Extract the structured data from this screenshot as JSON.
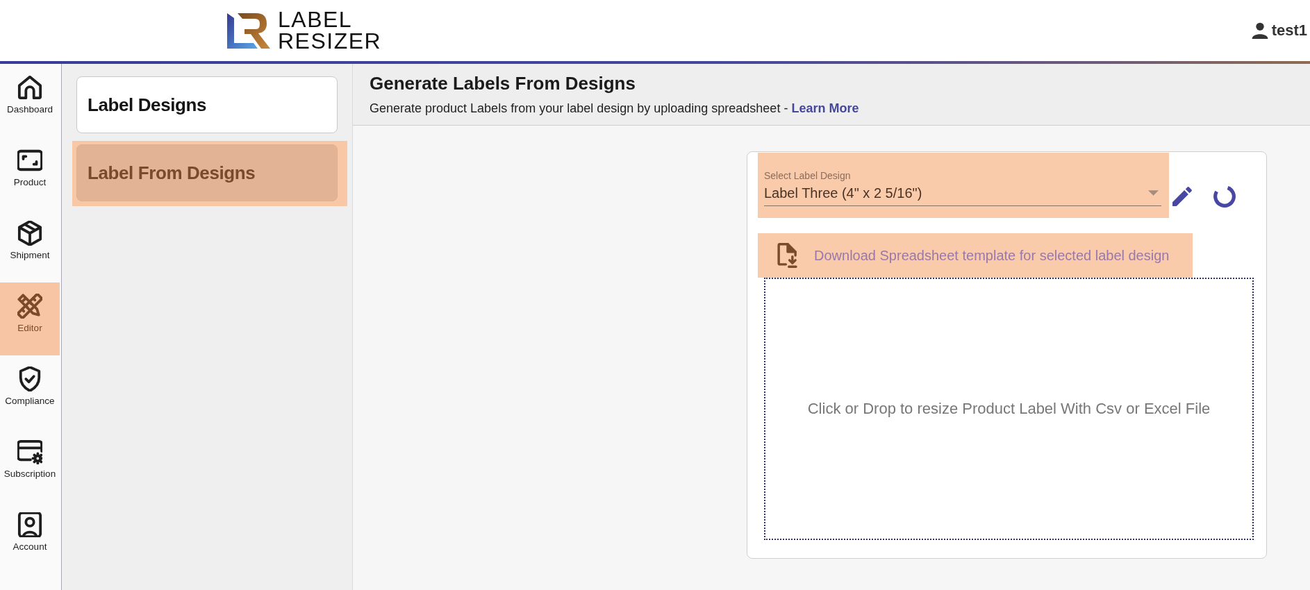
{
  "header": {
    "logo": {
      "lines": [
        "LABEL",
        "RESIZER"
      ]
    },
    "user": {
      "name": "test1"
    }
  },
  "nav": [
    {
      "label": "Dashboard",
      "selected": false
    },
    {
      "label": "Product",
      "selected": false
    },
    {
      "label": "Shipment",
      "selected": false
    },
    {
      "label": "Editor",
      "selected": true
    },
    {
      "label": "Compliance",
      "selected": false
    },
    {
      "label": "Subscription",
      "selected": false
    },
    {
      "label": "Account",
      "selected": false
    }
  ],
  "submenu": [
    {
      "label": "Label Designs",
      "selected": false
    },
    {
      "label": "Label From Designs",
      "selected": true
    }
  ],
  "page": {
    "title": "Generate Labels From Designs",
    "subtitle": "Generate product Labels from your label design by uploading spreadsheet -",
    "link": "Learn More"
  },
  "form": {
    "select": {
      "label": "Select Label Design",
      "value": "Label Three (4\" x 2 5/16\")",
      "highlighted": true
    },
    "download": {
      "text": "Download Spreadsheet template for selected label design",
      "highlighted": true
    },
    "dropzone": {
      "text": "Click or Drop to resize Product Label With Csv or Excel File"
    }
  }
}
